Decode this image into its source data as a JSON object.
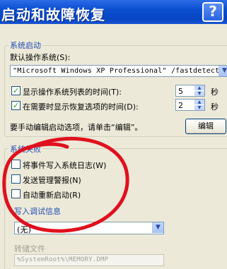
{
  "title": "启动和故障恢复",
  "help_button": "?",
  "startup": {
    "group_label": "系统启动",
    "default_os_label": "默认操作系统",
    "default_os_key": "(S):",
    "default_os_value": "\"Microsoft Windows XP Professional\" /fastdetect /NoE",
    "show_list_label": "显示操作系统列表的时间",
    "show_list_key": "(T):",
    "show_list_value": "5",
    "show_list_unit": "秒",
    "show_recovery_label": "在需要时显示恢复选项的时间",
    "show_recovery_key": "(D):",
    "show_recovery_value": "2",
    "show_recovery_unit": "秒",
    "edit_hint": "要手动编辑启动选项，请单击“编辑”。",
    "edit_button": "编辑"
  },
  "failure": {
    "group_label": "系统失败",
    "write_event_label": "将事件写入系统日志",
    "write_event_key": "(W)",
    "send_alert_label": "发送管理警报",
    "send_alert_key": "(N)",
    "auto_restart_label": "自动重新启动",
    "auto_restart_key": "(R)"
  },
  "debug": {
    "label": "写入调试信息",
    "dropdown_value": "(无)",
    "dump_file_label": "转储文件",
    "dump_file_value": "%SystemRoot%\\MEMORY.DMP"
  },
  "colors": {
    "titlebar": "#0a4fd0",
    "group_label": "#1f4bb5",
    "annotation": "#e0101e"
  },
  "icons": {
    "check": "check-icon",
    "dropdown": "chevron-down-icon"
  }
}
